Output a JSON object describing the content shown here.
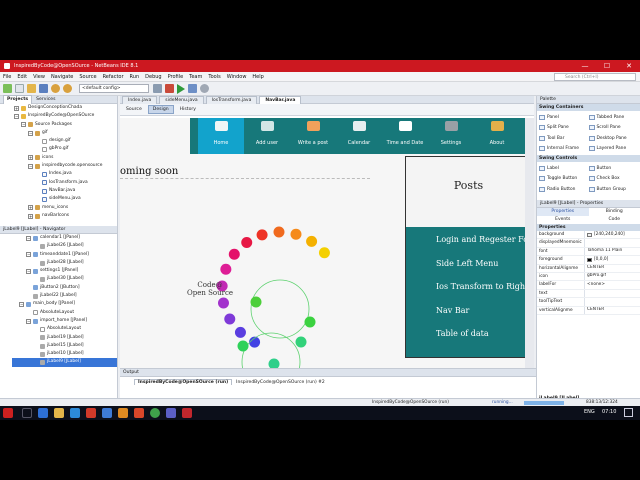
{
  "window": {
    "title": "InspiredByCode@OpenSOurce - NetBeans IDE 8.1",
    "minimize": "—",
    "maximize": "☐",
    "close": "✕"
  },
  "menu": [
    "File",
    "Edit",
    "View",
    "Navigate",
    "Source",
    "Refactor",
    "Run",
    "Debug",
    "Profile",
    "Team",
    "Tools",
    "Window",
    "Help"
  ],
  "search": {
    "placeholder": "Search (Ctrl+I)"
  },
  "toolbar": {
    "config": "<default config>"
  },
  "projects_panel": {
    "tab_projects": "Projects",
    "tab_services": "Services"
  },
  "project_tree": [
    {
      "t": "DesignConceptionChada",
      "d": 0,
      "i": "folder",
      "g": "+"
    },
    {
      "t": "InspiredByCode@OpenSOurce",
      "d": 0,
      "i": "folder",
      "g": "−"
    },
    {
      "t": "Source Packages",
      "d": 1,
      "i": "pkg",
      "g": "−"
    },
    {
      "t": "gif",
      "d": 2,
      "i": "pkg",
      "g": "−"
    },
    {
      "t": "design.gif",
      "d": 3,
      "i": "file",
      "g": ""
    },
    {
      "t": "gbPro.gif",
      "d": 3,
      "i": "file",
      "g": ""
    },
    {
      "t": "icons",
      "d": 2,
      "i": "pkg",
      "g": "+"
    },
    {
      "t": "inspiredbycode.opensource",
      "d": 2,
      "i": "pkg",
      "g": "−"
    },
    {
      "t": "Index.java",
      "d": 3,
      "i": "java",
      "g": ""
    },
    {
      "t": "IosTransform.java",
      "d": 3,
      "i": "java",
      "g": ""
    },
    {
      "t": "NavBar.java",
      "d": 3,
      "i": "java",
      "g": ""
    },
    {
      "t": "sideMenu.java",
      "d": 3,
      "i": "java",
      "g": ""
    },
    {
      "t": "menu_icons",
      "d": 2,
      "i": "pkg",
      "g": "+"
    },
    {
      "t": "navBarIcons",
      "d": 2,
      "i": "pkg",
      "g": "+"
    }
  ],
  "navigator": {
    "title": "jLabel9 [JLabel] - Navigator"
  },
  "navigator_tree": [
    {
      "t": "calendar1 [JPanel]",
      "d": 2,
      "i": "comp",
      "g": "−"
    },
    {
      "t": "jLabel26 [JLabel]",
      "d": 3,
      "i": "label",
      "g": ""
    },
    {
      "t": "timeanddate1 [JPanel]",
      "d": 2,
      "i": "comp",
      "g": "−"
    },
    {
      "t": "jLabel28 [JLabel]",
      "d": 3,
      "i": "label",
      "g": ""
    },
    {
      "t": "settings1 [JPanel]",
      "d": 2,
      "i": "comp",
      "g": "−"
    },
    {
      "t": "jLabel30 [JLabel]",
      "d": 3,
      "i": "label",
      "g": ""
    },
    {
      "t": "jButton2 [JButton]",
      "d": 2,
      "i": "comp",
      "g": ""
    },
    {
      "t": "jLabel22 [JLabel]",
      "d": 2,
      "i": "label",
      "g": ""
    },
    {
      "t": "main_body [JPanel]",
      "d": 1,
      "i": "comp",
      "g": "−"
    },
    {
      "t": "AbsoluteLayout",
      "d": 2,
      "i": "file",
      "g": ""
    },
    {
      "t": "import_home [JPanel]",
      "d": 2,
      "i": "comp",
      "g": "−"
    },
    {
      "t": "AbsoluteLayout",
      "d": 3,
      "i": "file",
      "g": ""
    },
    {
      "t": "jLabel19 [JLabel]",
      "d": 3,
      "i": "label",
      "g": ""
    },
    {
      "t": "jLabel15 [JLabel]",
      "d": 3,
      "i": "label",
      "g": ""
    },
    {
      "t": "jLabel10 [JLabel]",
      "d": 3,
      "i": "label",
      "g": ""
    },
    {
      "t": "jLabel9 [JLabel]",
      "d": 3,
      "i": "label",
      "g": "",
      "sel": true
    }
  ],
  "editor_tabs": [
    {
      "t": "Index.java",
      "active": false
    },
    {
      "t": "sideMenu.java",
      "active": false
    },
    {
      "t": "IosTransform.java",
      "active": false
    },
    {
      "t": "NavBar.java",
      "active": true
    }
  ],
  "editor_subtabs": [
    "Source",
    "Design",
    "History"
  ],
  "design": {
    "coming_soon": "oming soon",
    "logo_line1": "Code@",
    "logo_line2": "Open Source",
    "nav_items": [
      "Home",
      "Add user",
      "Write a post",
      "Calendar",
      "Time and Date",
      "Settings",
      "About"
    ],
    "posts_title": "Posts",
    "posts": [
      "Login and Regester Form",
      "Side Left Menu",
      "Ios Transform to Right side",
      "Nav Bar",
      "Table of data"
    ]
  },
  "palette": {
    "title": "Palette",
    "groups": [
      {
        "name": "Swing Containers",
        "items": [
          "Panel",
          "Tabbed Pane",
          "Split Pane",
          "Scroll Pane",
          "Tool Bar",
          "Desktop Pane",
          "Internal Frame",
          "Layered Pane"
        ]
      },
      {
        "name": "Swing Controls",
        "items": [
          "Label",
          "Button",
          "Toggle Button",
          "Check Box",
          "Radio Button",
          "Button Group"
        ]
      }
    ]
  },
  "properties": {
    "title": "jLabel9 [JLabel] - Properties",
    "tabs": [
      "Properties",
      "Binding",
      "Events",
      "Code"
    ],
    "section": "Properties",
    "rows": [
      {
        "k": "background",
        "v": "[240,240,240]",
        "sw": "#f0f0f0"
      },
      {
        "k": "displayedMnemonic",
        "v": ""
      },
      {
        "k": "font",
        "v": "Tahoma 11 Plain"
      },
      {
        "k": "foreground",
        "v": "[0,0,0]",
        "sw": "#000000"
      },
      {
        "k": "horizontalAlignme",
        "v": "CENTER"
      },
      {
        "k": "icon",
        "v": "gbPro.gif"
      },
      {
        "k": "labelFor",
        "v": "<none>"
      },
      {
        "k": "text",
        "v": ""
      },
      {
        "k": "toolTipText",
        "v": ""
      },
      {
        "k": "verticalAlignme",
        "v": "CENTER"
      }
    ],
    "footer": "jLabel9 [JLabel]"
  },
  "output": {
    "title": "Output",
    "tab1": "InspiredByCode@OpenSOurce (run)",
    "tab2": "InspiredByCode@OpenSOurce (run) #2"
  },
  "status": {
    "process": "InspiredByCode@OpenSOurce (run)",
    "state": "running...",
    "position": "838:13/12:324"
  },
  "taskbar": {
    "lang": "ENG",
    "time": "07:10"
  },
  "colors": {
    "netbeans_red": "#cc1820",
    "teal": "#17787a"
  }
}
